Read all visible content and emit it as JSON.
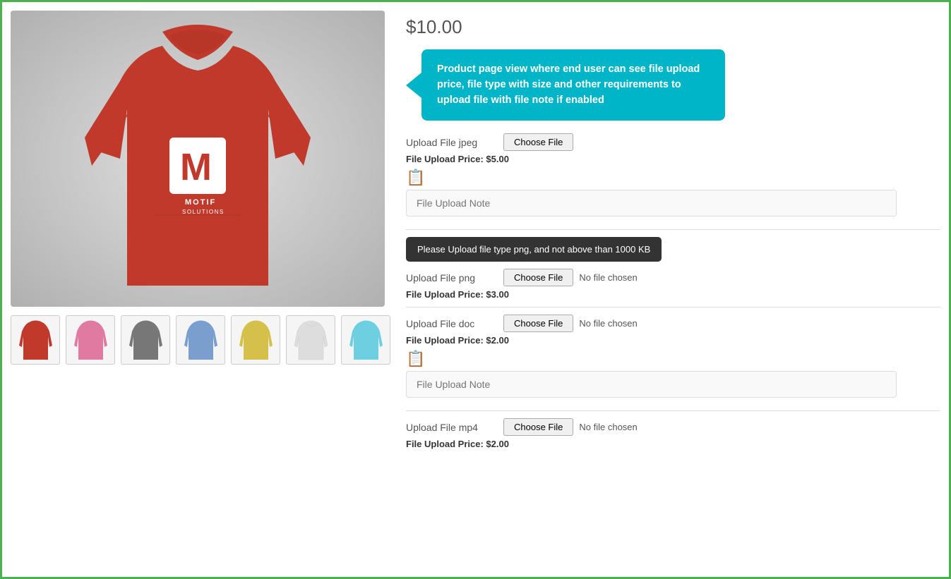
{
  "product": {
    "price": "$10.00",
    "callout_text": "Product page view where end user can see file upload price, file type with size and other requirements to upload file with file note if enabled"
  },
  "uploads": [
    {
      "id": "jpeg",
      "label": "Upload File jpeg",
      "button_text": "Choose File",
      "no_file_text": "",
      "price_label": "File Upload Price: $5.00",
      "has_note": true,
      "note_placeholder": "File Upload Note",
      "tooltip": null
    },
    {
      "id": "png",
      "label": "Upload File png",
      "button_text": "Choose File",
      "no_file_text": "No file chosen",
      "price_label": "File Upload Price: $3.00",
      "has_note": false,
      "note_placeholder": null,
      "tooltip": "Please Upload file type png, and not above than 1000 KB"
    },
    {
      "id": "doc",
      "label": "Upload File doc",
      "button_text": "Choose File",
      "no_file_text": "No file chosen",
      "price_label": "File Upload Price: $2.00",
      "has_note": true,
      "note_placeholder": "File Upload Note",
      "tooltip": null
    },
    {
      "id": "mp4",
      "label": "Upload File mp4",
      "button_text": "Choose File",
      "no_file_text": "No file chosen",
      "price_label": "File Upload Price: $2.00",
      "has_note": false,
      "note_placeholder": null,
      "tooltip": null
    }
  ],
  "thumbnails": [
    {
      "color": "#e63535",
      "label": "red"
    },
    {
      "color": "#e07aa0",
      "label": "pink"
    },
    {
      "color": "#666666",
      "label": "gray"
    },
    {
      "color": "#7a9fcf",
      "label": "blue"
    },
    {
      "color": "#e8d96a",
      "label": "yellow"
    },
    {
      "color": "#f0f0f0",
      "label": "white"
    },
    {
      "color": "#6ecfe0",
      "label": "light-blue"
    }
  ]
}
